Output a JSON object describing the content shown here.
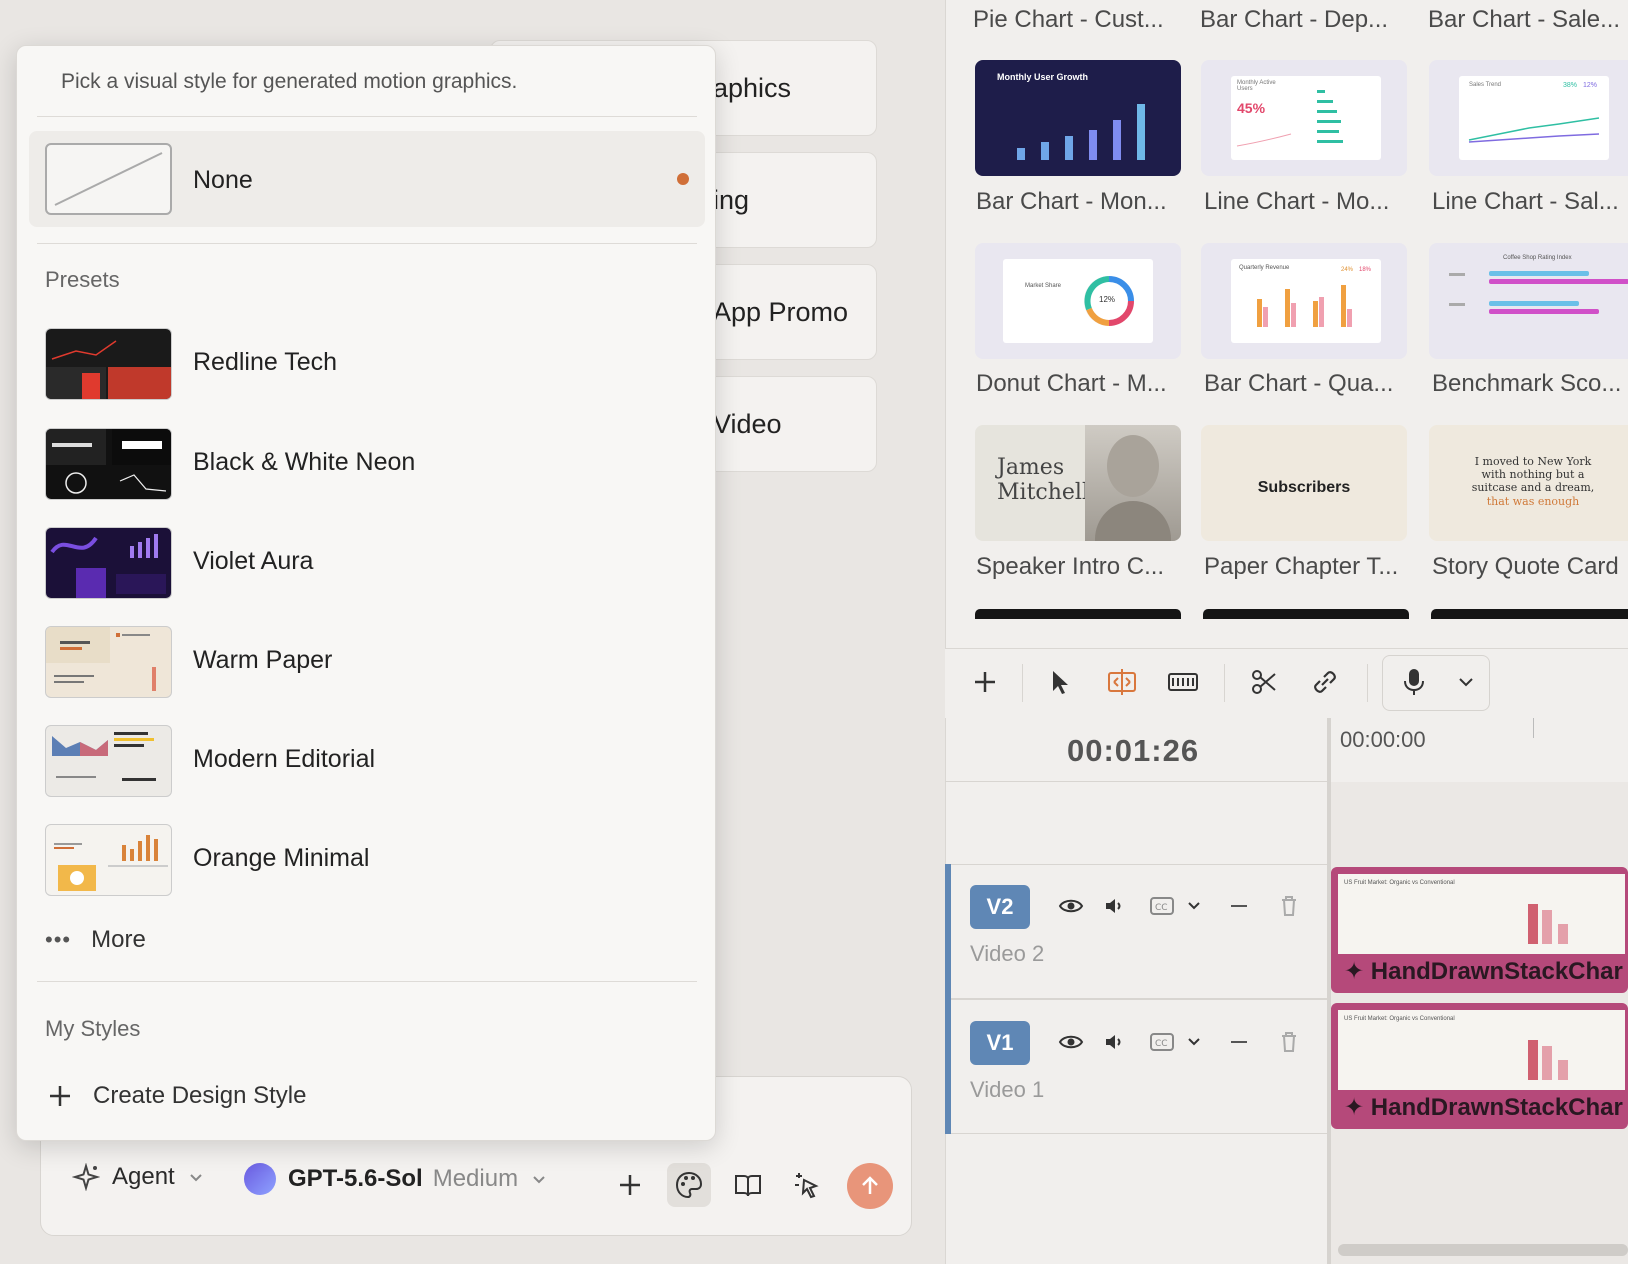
{
  "background_cards": [
    {
      "label": "aphics"
    },
    {
      "label": "ing"
    },
    {
      "label": "App Promo"
    },
    {
      "label": "Video"
    }
  ],
  "agent_bar": {
    "mode_label": "Agent",
    "model_name": "GPT-5.6-Sol",
    "model_effort": "Medium",
    "icons": [
      "add-icon",
      "palette-icon",
      "book-icon",
      "cursor-sparkle-icon",
      "send-up-icon"
    ],
    "accent_color": "#e8957a"
  },
  "popup": {
    "description": "Pick a visual style for generated motion graphics.",
    "none_label": "None",
    "selected_dot_color": "#d06f38",
    "presets_heading": "Presets",
    "presets": [
      {
        "label": "Redline Tech"
      },
      {
        "label": "Black & White Neon"
      },
      {
        "label": "Violet Aura"
      },
      {
        "label": "Warm Paper"
      },
      {
        "label": "Modern Editorial"
      },
      {
        "label": "Orange Minimal"
      }
    ],
    "more_label": "More",
    "my_styles_heading": "My Styles",
    "create_label": "Create Design Style"
  },
  "templates": {
    "top_row": [
      "Pie Chart - Cust...",
      "Bar Chart - Dep...",
      "Bar Chart - Sale..."
    ],
    "rows": [
      {
        "items": [
          {
            "title": "Bar Chart - Mon...",
            "thumb_text": "Monthly User Growth"
          },
          {
            "title": "Line Chart - Mo...",
            "thumb_text": "Monthly Active Users",
            "thumb_value": "45%"
          },
          {
            "title": "Line Chart - Sal...",
            "thumb_text": "Sales Trend",
            "thumb_value": "38%",
            "thumb_value2": "12%"
          }
        ]
      },
      {
        "items": [
          {
            "title": "Donut Chart - M...",
            "thumb_text": "Market Share",
            "thumb_value": "12%"
          },
          {
            "title": "Bar Chart - Qua...",
            "thumb_text": "Quarterly Revenue",
            "thumb_value": "24%",
            "thumb_value2": "18%"
          },
          {
            "title": "Benchmark Sco...",
            "thumb_text": "Coffee Shop Rating Index"
          }
        ]
      },
      {
        "items": [
          {
            "title": "Speaker Intro C...",
            "thumb_text": "James Mitchell"
          },
          {
            "title": "Paper Chapter T...",
            "thumb_text": "Subscribers"
          },
          {
            "title": "Story Quote Card",
            "thumb_text": "I moved to New York with nothing but a suitcase and a dream,",
            "thumb_text2": "that was enough"
          }
        ]
      }
    ]
  },
  "timeline": {
    "current_time": "00:01:26",
    "ruler_start": "00:00:00",
    "tracks": [
      {
        "badge": "V2",
        "name": "Video 2",
        "clip_label": "✦ HandDrawnStackChar",
        "clip_thumb_text": "US Fruit Market: Organic vs Conventional"
      },
      {
        "badge": "V1",
        "name": "Video 1",
        "clip_label": "✦ HandDrawnStackChar",
        "clip_thumb_text": "US Fruit Market: Organic vs Conventional"
      }
    ],
    "track_color": "#5f87b5",
    "clip_color": "#b5497a"
  }
}
